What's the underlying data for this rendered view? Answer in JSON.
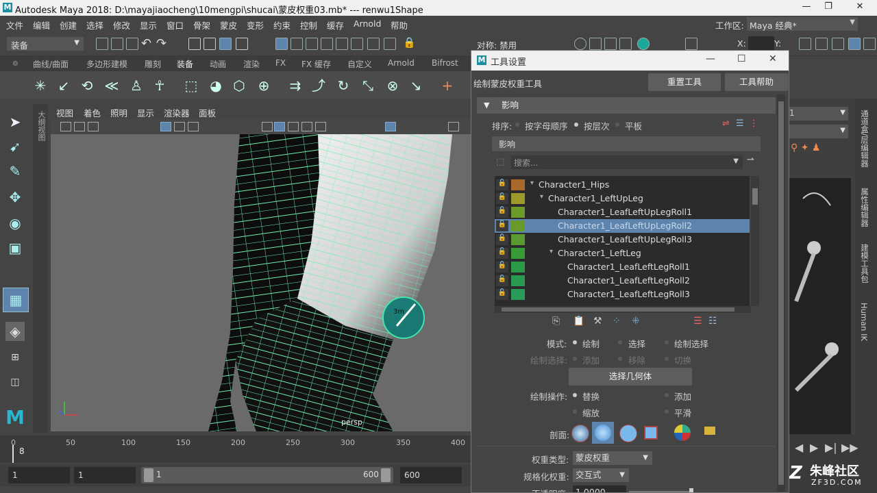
{
  "app": {
    "title": "Autodesk Maya 2018: D:\\mayajiaocheng\\10mengpi\\shucai\\蒙皮权重03.mb*   ---   renwu1Shape"
  },
  "window_controls": {
    "minimize": "—",
    "restore": "❐",
    "close": "✕"
  },
  "menubar": [
    "文件",
    "编辑",
    "创建",
    "选择",
    "修改",
    "显示",
    "窗口",
    "骨架",
    "蒙皮",
    "变形",
    "约束",
    "控制",
    "缓存",
    "Arnold",
    "帮助"
  ],
  "workspace": {
    "label": "工作区:",
    "value": "Maya 经典*"
  },
  "status": {
    "menu_set": "装备",
    "symmetry": "对称: 禁用",
    "x_label": "X:",
    "y_label": "Y:"
  },
  "shelf_tabs": [
    "曲线/曲面",
    "多边形建模",
    "雕刻",
    "装备",
    "动画",
    "渲染",
    "FX",
    "FX 缓存",
    "自定义",
    "Arnold",
    "Bifrost"
  ],
  "shelf_active": "装备",
  "side_tabs": {
    "outliner": "大纲视图"
  },
  "viewport": {
    "menus": [
      "视图",
      "着色",
      "照明",
      "显示",
      "渲染器",
      "面板"
    ],
    "camera": "persp",
    "brush_label": "3m"
  },
  "timeline": {
    "ticks": [
      "0",
      "50",
      "100",
      "150",
      "200",
      "250",
      "300",
      "350",
      "400"
    ],
    "current_frame": "8",
    "range": {
      "start": "1",
      "anim_start": "1",
      "slider_start": "1",
      "slider_end": "600",
      "end": "600"
    }
  },
  "right_tabs": [
    "通道盒/层编辑器",
    "属性编辑器",
    "建模工具包",
    "Human IK"
  ],
  "right_panel": {
    "field_value": "1"
  },
  "watermark": {
    "brand": "朱峰社区",
    "url": "ZF3D.COM"
  },
  "tool_settings": {
    "window_title": "工具设置",
    "tool_name": "绘制蒙皮权重工具",
    "reset_button": "重置工具",
    "help_button": "工具帮助",
    "section_influence": "影响",
    "sort_label": "排序:",
    "sort_options": [
      {
        "label": "按字母顺序",
        "selected": false
      },
      {
        "label": "按层次",
        "selected": true
      },
      {
        "label": "平板",
        "selected": false
      }
    ],
    "influence_header": "影响",
    "search_placeholder": "搜索...",
    "influences": [
      {
        "name": "Character1_Hips",
        "color": "#a86a2a",
        "indent": 0,
        "expander": "▾",
        "selected": false
      },
      {
        "name": "Character1_LeftUpLeg",
        "color": "#9c9a2a",
        "indent": 1,
        "expander": "▾",
        "selected": false
      },
      {
        "name": "Character1_LeafLeftUpLegRoll1",
        "color": "#6a9a2a",
        "indent": 2,
        "expander": "",
        "selected": false
      },
      {
        "name": "Character1_LeafLeftUpLegRoll2",
        "color": "#6a9a2a",
        "indent": 2,
        "expander": "",
        "selected": true
      },
      {
        "name": "Character1_LeafLeftUpLegRoll3",
        "color": "#5a9a30",
        "indent": 2,
        "expander": "",
        "selected": false
      },
      {
        "name": "Character1_LeftLeg",
        "color": "#3a9a38",
        "indent": 2,
        "expander": "▾",
        "selected": false
      },
      {
        "name": "Character1_LeafLeftLegRoll1",
        "color": "#2a9a48",
        "indent": 3,
        "expander": "",
        "selected": false
      },
      {
        "name": "Character1_LeafLeftLegRoll2",
        "color": "#2a9a50",
        "indent": 3,
        "expander": "",
        "selected": false
      },
      {
        "name": "Character1_LeafLeftLegRoll3",
        "color": "#2a9a58",
        "indent": 3,
        "expander": "",
        "selected": false
      }
    ],
    "mode_label": "模式:",
    "mode_options": [
      {
        "label": "绘制",
        "selected": true
      },
      {
        "label": "选择",
        "selected": false
      },
      {
        "label": "绘制选择",
        "selected": false
      }
    ],
    "paint_select_label": "绘制选择:",
    "paint_select_options": [
      {
        "label": "添加"
      },
      {
        "label": "移除"
      },
      {
        "label": "切换"
      }
    ],
    "select_geometry_button": "选择几何体",
    "paint_op_label": "绘制操作:",
    "paint_ops": [
      {
        "label": "替换",
        "selected": true
      },
      {
        "label": "添加",
        "selected": false
      },
      {
        "label": "缩放",
        "selected": false
      },
      {
        "label": "平滑",
        "selected": false
      }
    ],
    "profile_label": "剖面:",
    "weight_type_label": "权重类型:",
    "weight_type_value": "蒙皮权重",
    "normalize_label": "规格化权重:",
    "normalize_value": "交互式",
    "opacity_label": "不透明度:",
    "opacity_value": "1.0000"
  },
  "colors": {
    "accent": "#5d84ad",
    "mesh_wire": "#6ff0b0",
    "brush": "#1aa89a"
  }
}
